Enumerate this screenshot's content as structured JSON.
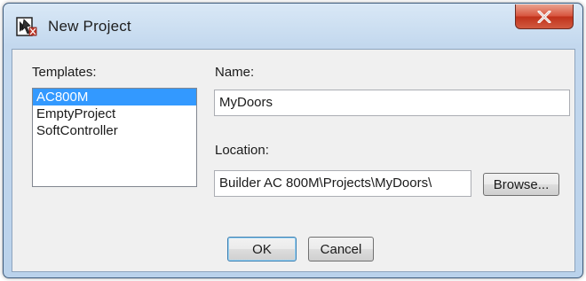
{
  "window": {
    "title": "New Project",
    "close_glyph": "✕"
  },
  "templates": {
    "label": "Templates:",
    "items": [
      "AC800M",
      "EmptyProject",
      "SoftController"
    ],
    "selected": "AC800M"
  },
  "name": {
    "label": "Name:",
    "value": "MyDoors"
  },
  "location": {
    "label": "Location:",
    "value": "Builder AC 800M\\Projects\\MyDoors\\"
  },
  "buttons": {
    "browse": "Browse...",
    "ok": "OK",
    "cancel": "Cancel"
  },
  "colors": {
    "selection": "#3399ff",
    "close_button": "#c7452f",
    "title_bar": "#c3d8ee"
  },
  "icons": {
    "app": "project-builder-icon",
    "close": "close-icon"
  }
}
